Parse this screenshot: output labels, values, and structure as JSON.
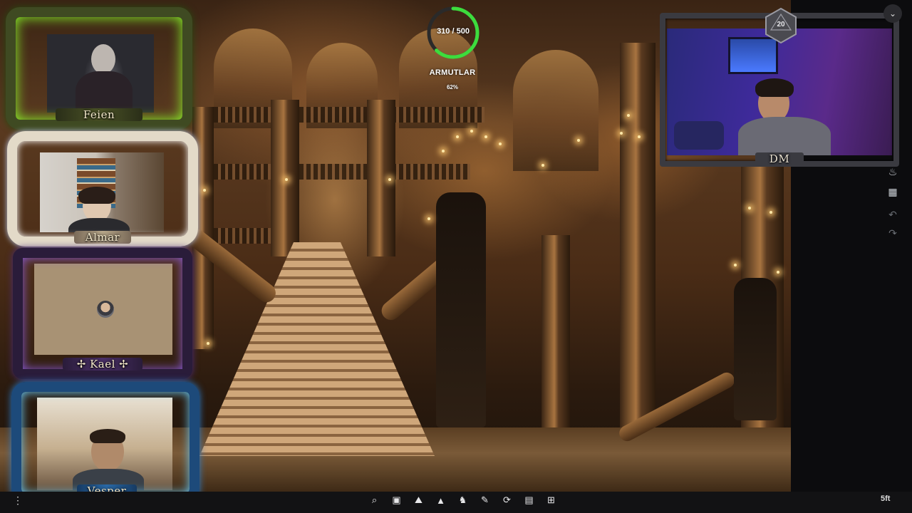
{
  "hp": {
    "current_max": "310 / 500",
    "fraction": 0.62
  },
  "npc": {
    "name": "ARMUTLAR",
    "percent": "62%"
  },
  "players": {
    "feien": "Feien",
    "almar": "Almar",
    "kael": "✢ Kael ✢",
    "vesper": "Vesper",
    "dm": "DM"
  },
  "dice_emblem": "20",
  "toolbar": {
    "icons": [
      "search-icon",
      "image-icon",
      "terrain-icon",
      "fog-icon",
      "creature-icon",
      "draw-icon",
      "rotate-icon",
      "notes-icon",
      "grid-icon"
    ],
    "glyphs": [
      "⌕",
      "▣",
      "⛰",
      "▲",
      "♞",
      "✎",
      "⟳",
      "▤",
      "⊞"
    ]
  },
  "scale": "5ft",
  "colors": {
    "hp_ring": "#3ddc3d",
    "hp_track": "#2a2a2a"
  }
}
